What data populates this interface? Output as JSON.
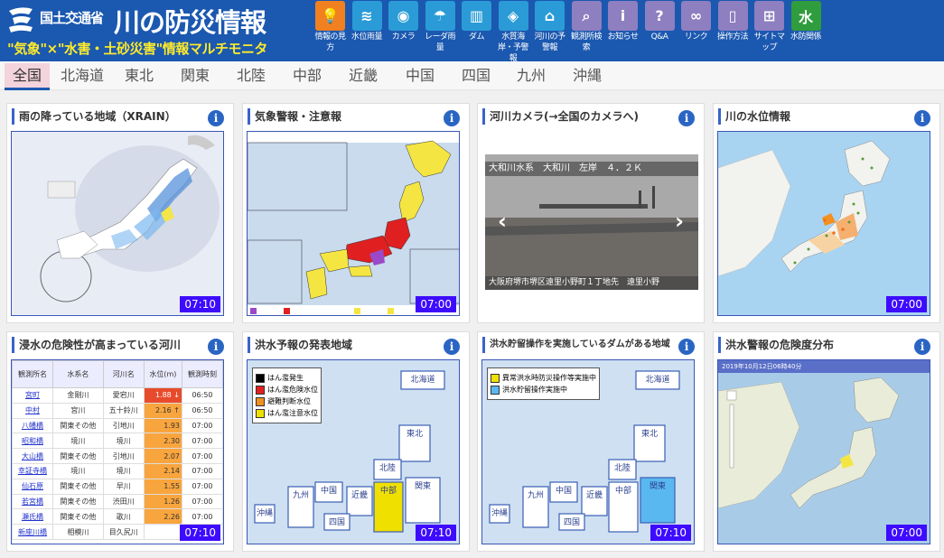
{
  "header": {
    "ministry": "国土交通省",
    "title": "川の防災情報",
    "subtitle": "\"気象\"×\"水害・土砂災害\"情報マルチモニタ"
  },
  "nav": [
    {
      "label": "情報の見方",
      "icon": "lightbulb-icon",
      "color": "#f08020"
    },
    {
      "label": "水位雨量",
      "icon": "water-gauge-icon",
      "color": "#2a9bd6"
    },
    {
      "label": "カメラ",
      "icon": "camera-icon",
      "color": "#2a9bd6"
    },
    {
      "label": "レーダ雨量",
      "icon": "rain-radar-icon",
      "color": "#2a9bd6"
    },
    {
      "label": "ダム",
      "icon": "dam-icon",
      "color": "#2a9bd6"
    },
    {
      "label": "水質海岸・予警報",
      "icon": "water-quality-icon",
      "color": "#2a9bd6"
    },
    {
      "label": "河川の予警報",
      "icon": "river-warning-icon",
      "color": "#2a9bd6"
    },
    {
      "label": "観測所検索",
      "icon": "search-icon",
      "color": "#8e7fc0"
    },
    {
      "label": "お知らせ",
      "icon": "info-icon",
      "color": "#8e7fc0"
    },
    {
      "label": "Q&A",
      "icon": "question-icon",
      "color": "#8e7fc0"
    },
    {
      "label": "リンク",
      "icon": "link-icon",
      "color": "#8e7fc0"
    },
    {
      "label": "操作方法",
      "icon": "mouse-icon",
      "color": "#8e7fc0"
    },
    {
      "label": "サイトマップ",
      "icon": "sitemap-icon",
      "color": "#8e7fc0"
    },
    {
      "label": "水防関係",
      "icon": "flood-defense-icon",
      "color": "#2f9c3d"
    }
  ],
  "regions": [
    "全国",
    "北海道",
    "東北",
    "関東",
    "北陸",
    "中部",
    "近畿",
    "中国",
    "四国",
    "九州",
    "沖縄"
  ],
  "active_region": "全国",
  "panels": {
    "rain": {
      "title": "雨の降っている地域（XRAIN）",
      "time": "07:10"
    },
    "warnings": {
      "title": "気象警報・注意報",
      "time": "07:00"
    },
    "camera": {
      "title": "河川カメラ(→全国のカメラへ)",
      "caption_top": "大和川水系　大和川　左岸　４．２Ｋ",
      "caption_bottom": "大阪府堺市堺区遠里小野町１丁地先　遠里小野"
    },
    "water_level": {
      "title": "川の水位情報",
      "time": "07:00"
    },
    "flood_danger": {
      "title": "浸水の危険性が高まっている河川",
      "time": "07:10",
      "headers": [
        "観測所名",
        "水系名",
        "河川名",
        "水位(m)",
        "観測時刻"
      ],
      "rows": [
        [
          "宮町",
          "金剛川",
          "愛宕川",
          "1.88 ↓",
          "06:50"
        ],
        [
          "中村",
          "宮川",
          "五十鈴川",
          "2.16 ↑",
          "06:50"
        ],
        [
          "八幡橋",
          "関東その他",
          "引地川",
          "1.93",
          "07:00"
        ],
        [
          "昭和橋",
          "境川",
          "境川",
          "2.30",
          "07:00"
        ],
        [
          "大山橋",
          "関東その他",
          "引地川",
          "2.07",
          "07:00"
        ],
        [
          "幸証寺橋",
          "境川",
          "境川",
          "2.14",
          "07:00"
        ],
        [
          "仙石原",
          "関東その他",
          "早川",
          "1.55",
          "07:00"
        ],
        [
          "若宮橋",
          "関東その他",
          "渋田川",
          "1.26",
          "07:00"
        ],
        [
          "瀬氏橋",
          "関東その他",
          "歌川",
          "2.26",
          "07:00"
        ],
        [
          "新座川橋",
          "相模川",
          "目久尻川",
          "",
          ""
        ]
      ]
    },
    "flood_forecast": {
      "title": "洪水予報の発表地域",
      "time": "07:10",
      "legend": [
        "はん濫発生",
        "はん濫危険水位",
        "避難判断水位",
        "はん濫注意水位"
      ],
      "legend_colors": [
        "#000000",
        "#e02020",
        "#f09020",
        "#f0e000"
      ],
      "regions": [
        "北海道",
        "東北",
        "北陸",
        "関東",
        "中部",
        "近畿",
        "中国",
        "四国",
        "九州",
        "沖縄"
      ]
    },
    "dam": {
      "title": "洪水貯留操作を実施しているダムがある地域",
      "time": "07:10",
      "legend": [
        "異常洪水時防災操作等実施中",
        "洪水貯留操作実施中"
      ],
      "legend_colors": [
        "#f0e000",
        "#5ab8f0"
      ],
      "regions": [
        "北海道",
        "東北",
        "北陸",
        "関東",
        "中部",
        "近畿",
        "中国",
        "四国",
        "九州",
        "沖縄"
      ]
    },
    "flood_alert": {
      "title": "洪水警報の危険度分布",
      "time": "07:00",
      "map_date": "2019年10月12日06時40分"
    }
  }
}
